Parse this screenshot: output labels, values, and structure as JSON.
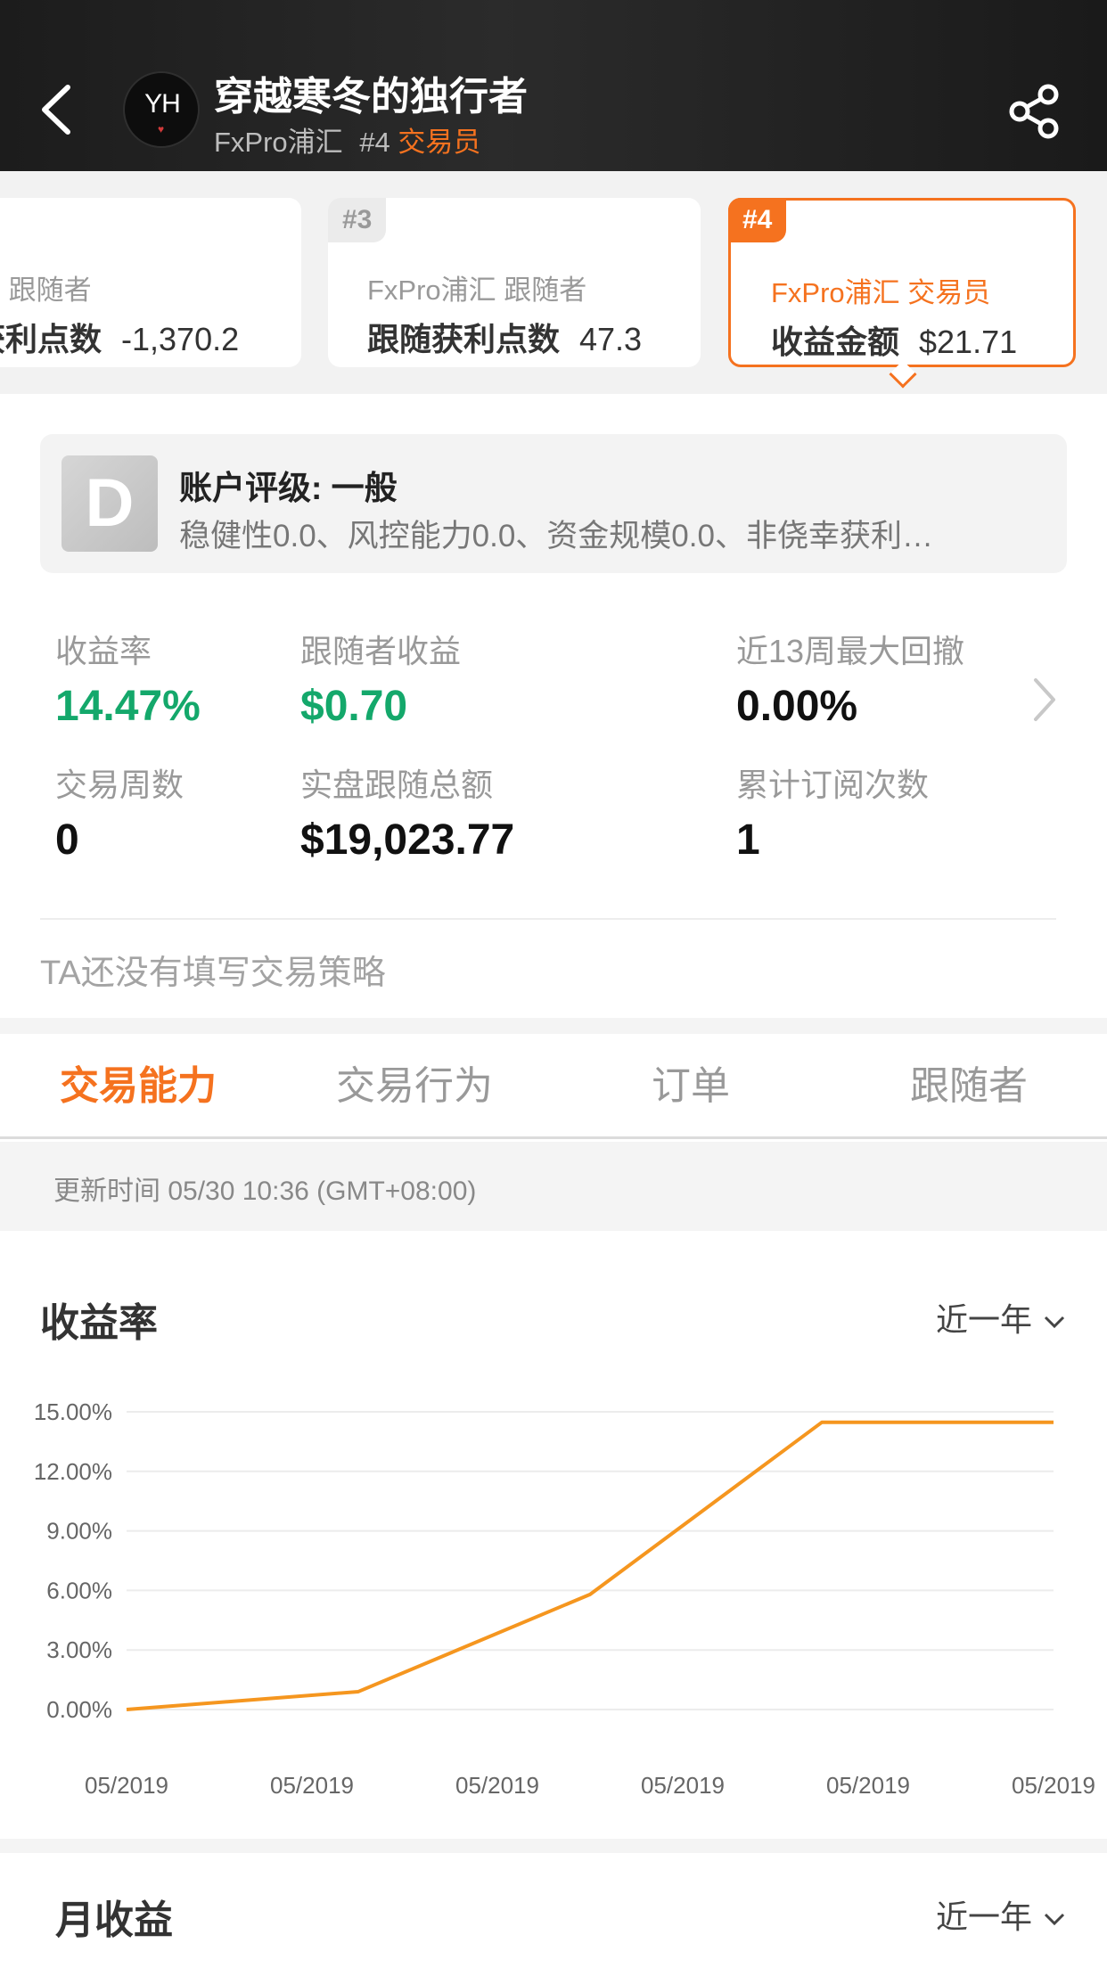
{
  "header": {
    "user_name": "穿越寒冬的独行者",
    "broker": "FxPro浦汇",
    "rank": "#4",
    "role": "交易员",
    "avatar_text": "YH"
  },
  "cards": [
    {
      "rank": "",
      "line1": "户  跟随者",
      "label": "获利点数",
      "value": "-1,370.2"
    },
    {
      "rank": "#3",
      "line1": "FxPro浦汇  跟随者",
      "label": "跟随获利点数",
      "value": "47.3"
    },
    {
      "rank": "#4",
      "line1": "FxPro浦汇  交易员",
      "label": "收益金额",
      "value": "$21.71"
    }
  ],
  "rating": {
    "grade": "D",
    "title": "账户评级: 一般",
    "desc": "稳健性0.0、风控能力0.0、资金规模0.0、非侥幸获利…"
  },
  "stats": {
    "return_rate": {
      "label": "收益率",
      "value": "14.47%"
    },
    "follower_profit": {
      "label": "跟随者收益",
      "value": "$0.70"
    },
    "max_drawdown": {
      "label": "近13周最大回撤",
      "value": "0.00%"
    },
    "trade_weeks": {
      "label": "交易周数",
      "value": "0"
    },
    "real_follow_total": {
      "label": "实盘跟随总额",
      "value": "$19,023.77"
    },
    "subscriptions": {
      "label": "累计订阅次数",
      "value": "1"
    }
  },
  "strategy_text": "TA还没有填写交易策略",
  "tabs": [
    {
      "label": "交易能力",
      "active": true
    },
    {
      "label": "交易行为",
      "active": false
    },
    {
      "label": "订单",
      "active": false
    },
    {
      "label": "跟随者",
      "active": false
    }
  ],
  "update_time": "更新时间 05/30 10:36 (GMT+08:00)",
  "return_section": {
    "title": "收益率",
    "range": "近一年"
  },
  "monthly_section": {
    "title": "月收益",
    "range": "近一年"
  },
  "colors": {
    "accent": "#f5721f",
    "positive": "#14a86b",
    "line": "#f5961f"
  },
  "chart_data": {
    "type": "line",
    "title": "收益率",
    "x": [
      "05/2019",
      "05/2019",
      "05/2019",
      "05/2019",
      "05/2019",
      "05/2019"
    ],
    "series": [
      {
        "values": [
          0.0,
          0.9,
          5.8,
          14.47,
          14.47
        ]
      }
    ],
    "point_x": [
      0,
      1.25,
      2.5,
      3.75,
      5.0
    ],
    "yticks": [
      "15.00%",
      "12.00%",
      "9.00%",
      "6.00%",
      "3.00%",
      "0.00%"
    ],
    "ylim": [
      0,
      15
    ],
    "grid": true
  }
}
